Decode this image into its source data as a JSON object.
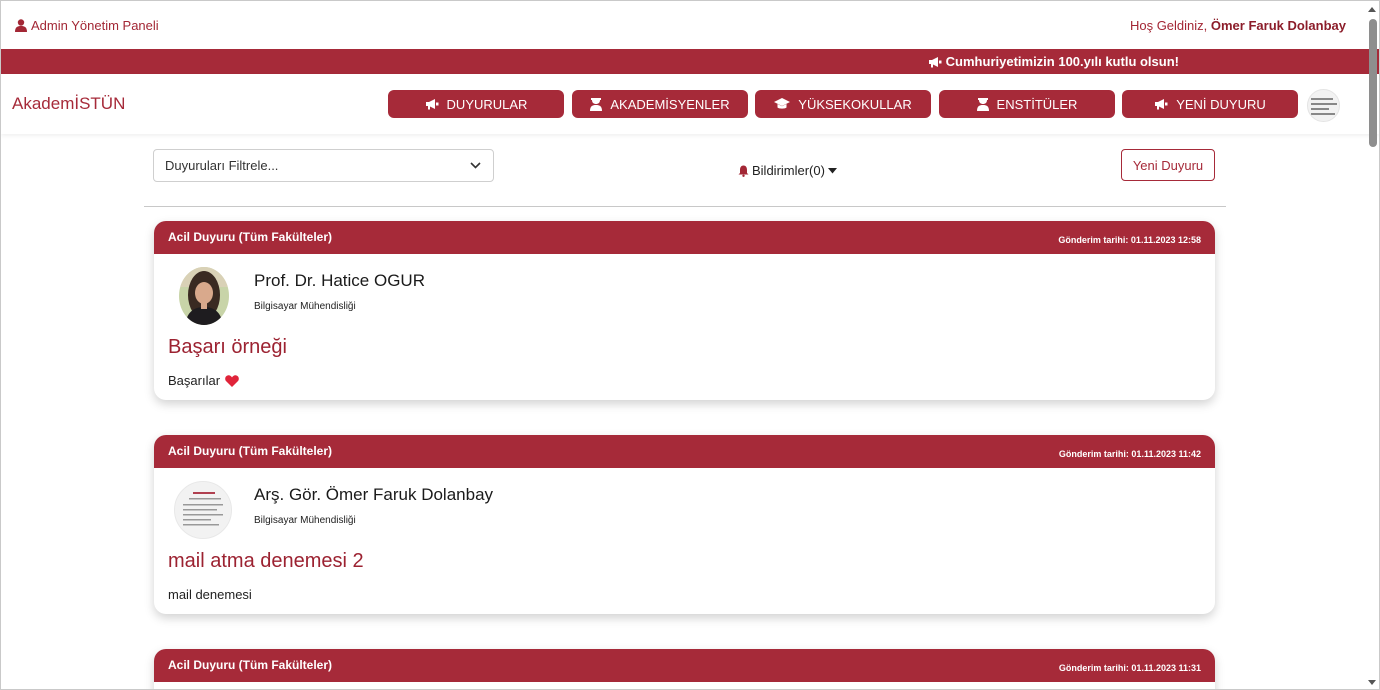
{
  "topbar": {
    "admin_label": "Admin Yönetim Paneli",
    "welcome_prefix": "Hoş Geldiniz, ",
    "user_name": "Ömer Faruk Dolanbay"
  },
  "ribbon": {
    "message": "Cumhuriyetimizin 100.yılı kutlu olsun!"
  },
  "navbar": {
    "brand": "AkademİSTÜN",
    "buttons": [
      {
        "label": "DUYURULAR",
        "icon": "megaphone-icon"
      },
      {
        "label": "AKADEMİSYENLER",
        "icon": "teacher-icon"
      },
      {
        "label": "YÜKSEKOKULLAR",
        "icon": "graduation-cap-icon"
      },
      {
        "label": "ENSTİTÜLER",
        "icon": "teacher-icon"
      },
      {
        "label": "YENİ DUYURU",
        "icon": "megaphone-icon"
      }
    ]
  },
  "toolbar": {
    "filter_placeholder": "Duyuruları Filtrele...",
    "notifications_label": "Bildirimler(0)",
    "new_announcement_button": "Yeni Duyuru"
  },
  "announcements": [
    {
      "category": "Acil Duyuru (Tüm Fakülteler)",
      "sent_at": "Gönderim tarihi: 01.11.2023 12:58",
      "author": "Prof. Dr. Hatice OGUR",
      "department": "Bilgisayar Mühendisliği",
      "title": "Başarı örneği",
      "body": "Başarılar"
    },
    {
      "category": "Acil Duyuru (Tüm Fakülteler)",
      "sent_at": "Gönderim tarihi: 01.11.2023 11:42",
      "author": "Arş. Gör. Ömer Faruk Dolanbay",
      "department": "Bilgisayar Mühendisliği",
      "title": "mail atma denemesi 2",
      "body": "mail denemesi"
    },
    {
      "category": "Acil Duyuru (Tüm Fakülteler)",
      "sent_at": "Gönderim tarihi: 01.11.2023 11:31"
    }
  ],
  "colors": {
    "brand": "#a62a39",
    "brand_dark": "#8c1d2a",
    "heart": "#e0243a"
  }
}
